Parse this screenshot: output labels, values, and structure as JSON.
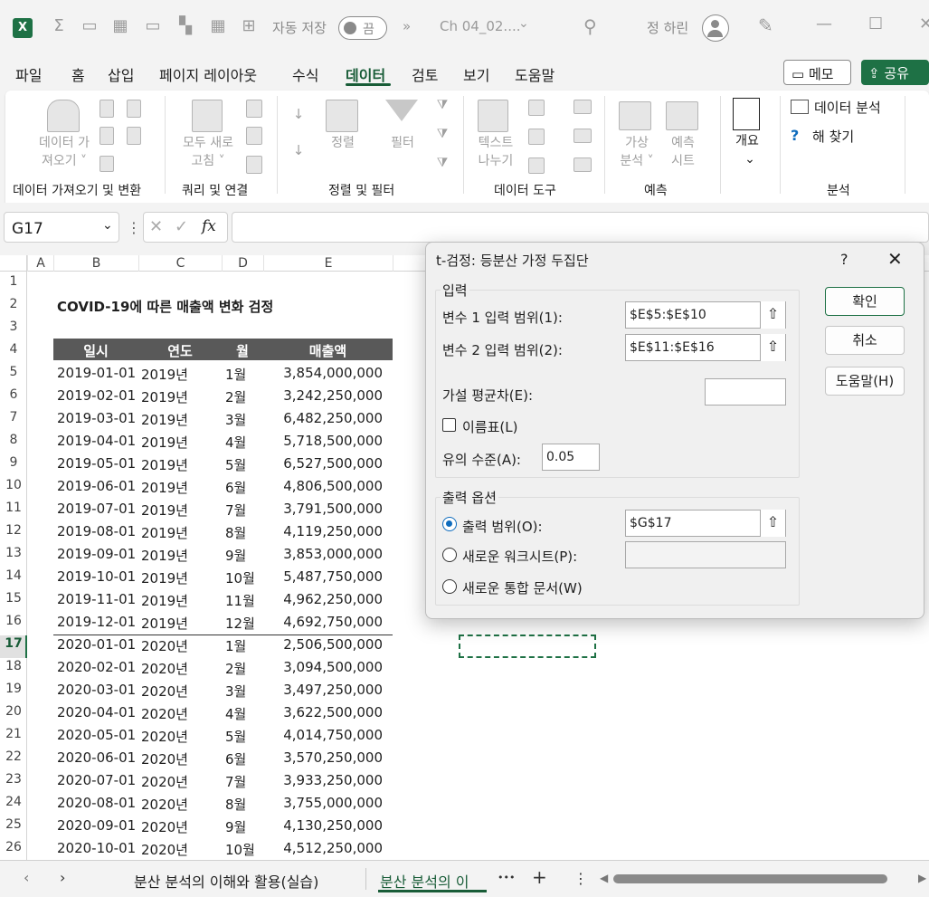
{
  "titlebar": {
    "autosave_label": "자동 저장",
    "autosave_state": "끔",
    "filename": "Ch 04_02....",
    "user": "정 하린",
    "more_tabs": "»"
  },
  "tabs": [
    "파일",
    "홈",
    "삽입",
    "페이지 레이아웃",
    "수식",
    "데이터",
    "검토",
    "보기",
    "도움말"
  ],
  "memo_label": "메모",
  "share_label": "공유",
  "ribbon": {
    "get_data": "데이터 가\n져오기 ˅",
    "refresh_all": "모두 새로\n고침 ˅",
    "sort": "정렬",
    "filter": "필터",
    "text_to_columns": "텍스트\n나누기",
    "what_if": "가상\n분석 ˅",
    "forecast_sheet": "예측\n시트",
    "outline": "개요",
    "data_analysis": "데이터 분석",
    "solver": "해 찾기",
    "groups": [
      "데이터 가져오기 및 변환",
      "쿼리 및 연결",
      "정렬 및 필터",
      "데이터 도구",
      "예측",
      "분석"
    ]
  },
  "namebox": "G17",
  "fx": "fx",
  "columns": [
    "A",
    "B",
    "C",
    "D",
    "E"
  ],
  "sheet": {
    "title": "COVID-19에 따른 매출액 변화 검정",
    "headers": [
      "일시",
      "연도",
      "월",
      "매출액"
    ],
    "rows": [
      [
        "2019-01-01",
        "2019년",
        "1월",
        "3,854,000,000"
      ],
      [
        "2019-02-01",
        "2019년",
        "2월",
        "3,242,250,000"
      ],
      [
        "2019-03-01",
        "2019년",
        "3월",
        "6,482,250,000"
      ],
      [
        "2019-04-01",
        "2019년",
        "4월",
        "5,718,500,000"
      ],
      [
        "2019-05-01",
        "2019년",
        "5월",
        "6,527,500,000"
      ],
      [
        "2019-06-01",
        "2019년",
        "6월",
        "4,806,500,000"
      ],
      [
        "2019-07-01",
        "2019년",
        "7월",
        "3,791,500,000"
      ],
      [
        "2019-08-01",
        "2019년",
        "8월",
        "4,119,250,000"
      ],
      [
        "2019-09-01",
        "2019년",
        "9월",
        "3,853,000,000"
      ],
      [
        "2019-10-01",
        "2019년",
        "10월",
        "5,487,750,000"
      ],
      [
        "2019-11-01",
        "2019년",
        "11월",
        "4,962,250,000"
      ],
      [
        "2019-12-01",
        "2019년",
        "12월",
        "4,692,750,000"
      ],
      [
        "2020-01-01",
        "2020년",
        "1월",
        "2,506,500,000"
      ],
      [
        "2020-02-01",
        "2020년",
        "2월",
        "3,094,500,000"
      ],
      [
        "2020-03-01",
        "2020년",
        "3월",
        "3,497,250,000"
      ],
      [
        "2020-04-01",
        "2020년",
        "4월",
        "3,622,500,000"
      ],
      [
        "2020-05-01",
        "2020년",
        "5월",
        "4,014,750,000"
      ],
      [
        "2020-06-01",
        "2020년",
        "6월",
        "3,570,250,000"
      ],
      [
        "2020-07-01",
        "2020년",
        "7월",
        "3,933,250,000"
      ],
      [
        "2020-08-01",
        "2020년",
        "8월",
        "3,755,000,000"
      ],
      [
        "2020-09-01",
        "2020년",
        "9월",
        "4,130,250,000"
      ],
      [
        "2020-10-01",
        "2020년",
        "10월",
        "4,512,250,000"
      ]
    ]
  },
  "sheet_tabs": {
    "tab1": "분산 분석의 이해와 활용(실습)",
    "tab2": "분산 분석의 이",
    "more": "•••",
    "add": "+"
  },
  "dialog": {
    "title": "t-검정: 등분산 가정 두집단",
    "help": "?",
    "input_section": "입력",
    "var1_label": "변수 1 입력 범위(1):",
    "var1_value": "$E$5:$E$10",
    "var2_label": "변수 2 입력 범위(2):",
    "var2_value": "$E$11:$E$16",
    "mean_diff_label": "가설 평균차(E):",
    "mean_diff_value": "",
    "labels_checkbox": "이름표(L)",
    "alpha_label": "유의 수준(A):",
    "alpha_value": "0.05",
    "output_section": "출력 옵션",
    "output_range_label": "출력 범위(O):",
    "output_range_value": "$G$17",
    "new_sheet_label": "새로운 워크시트(P):",
    "new_workbook_label": "새로운 통합 문서(W)",
    "ok": "확인",
    "cancel": "취소",
    "help_btn": "도움말(H)"
  }
}
